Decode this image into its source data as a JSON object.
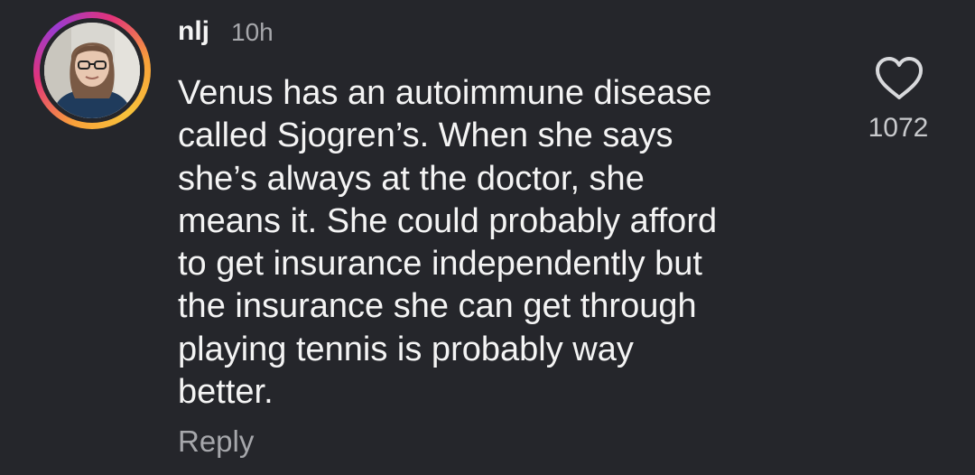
{
  "comment": {
    "username": "nlj",
    "timestamp": "10h",
    "lines": [
      "Venus has an autoimmune disease",
      "called Sjogren’s. When she says",
      "she’s always at the doctor, she",
      "means it. She could probably afford",
      "to get insurance independently but",
      "the insurance she can get through",
      "playing tennis is probably way",
      "better."
    ],
    "reply_label": "Reply",
    "like_count": "1072",
    "like_icon": "heart-outline-icon"
  },
  "colors": {
    "background": "#25262b",
    "text_primary": "#f4f4f4",
    "text_secondary": "#a6a7ab",
    "story_ring_start": "#f9a13a",
    "story_ring_end": "#e2337a"
  }
}
